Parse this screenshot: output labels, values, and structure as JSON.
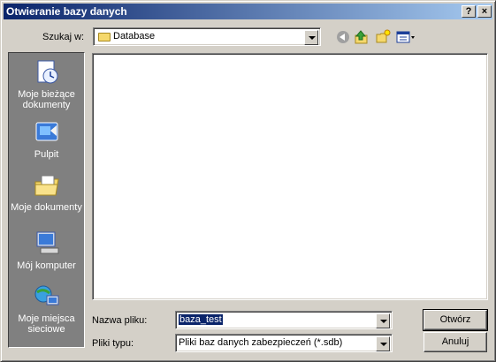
{
  "window": {
    "title": "Otwieranie bazy danych"
  },
  "titlebar": {
    "help": "?",
    "close": "×"
  },
  "lookin": {
    "label": "Szukaj w:",
    "value": "Database"
  },
  "toolbar": {
    "back_icon": "back-arrow-icon",
    "up_icon": "up-folder-icon",
    "new_folder_icon": "new-folder-icon",
    "views_icon": "views-menu-icon"
  },
  "places": [
    {
      "label": "Moje bieżące dokumenty",
      "icon": "recent-documents-icon"
    },
    {
      "label": "Pulpit",
      "icon": "desktop-icon"
    },
    {
      "label": "Moje dokumenty",
      "icon": "my-documents-icon"
    },
    {
      "label": "Mój komputer",
      "icon": "my-computer-icon"
    },
    {
      "label": "Moje miejsca sieciowe",
      "icon": "network-places-icon"
    }
  ],
  "filename": {
    "label": "Nazwa pliku:",
    "value": "baza_test"
  },
  "filetype": {
    "label": "Pliki typu:",
    "value": "Pliki baz danych zabezpieczeń (*.sdb)"
  },
  "buttons": {
    "open": "Otwórz",
    "cancel": "Anuluj"
  }
}
